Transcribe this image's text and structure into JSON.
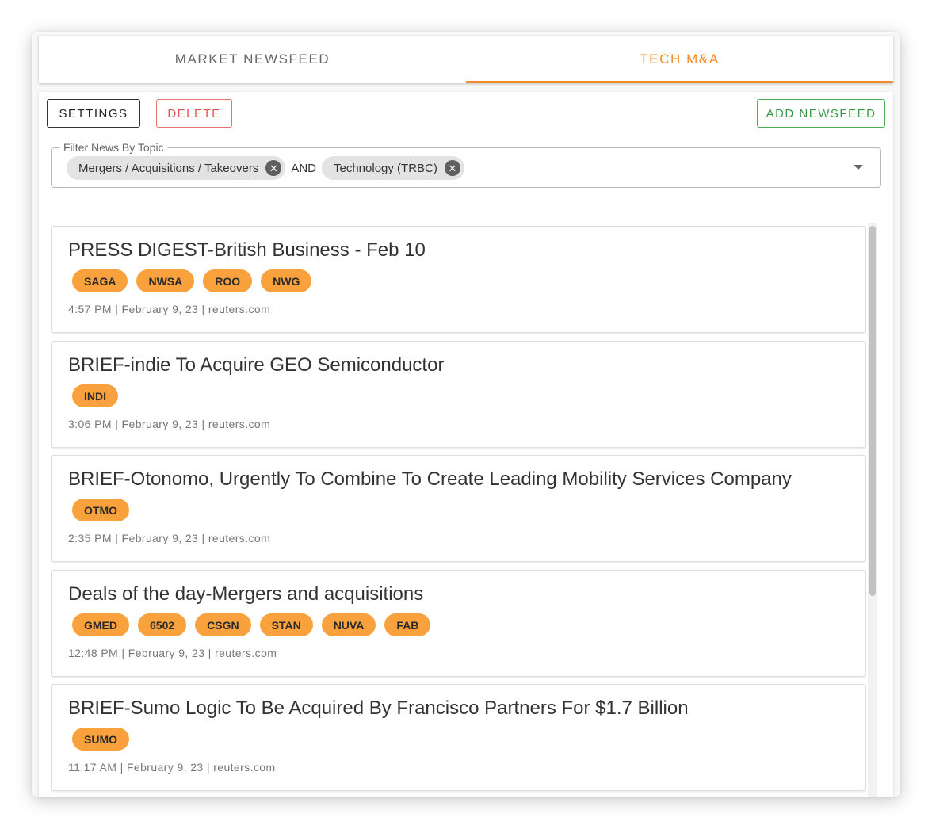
{
  "tabs": [
    {
      "label": "MARKET NEWSFEED",
      "active": false
    },
    {
      "label": "TECH M&A",
      "active": true
    }
  ],
  "toolbar": {
    "settings_label": "SETTINGS",
    "delete_label": "DELETE",
    "add_label": "ADD NEWSFEED"
  },
  "filter": {
    "label": "Filter News By Topic",
    "chips": [
      "Mergers / Acquisitions / Takeovers",
      "Technology (TRBC)"
    ],
    "joiner": "AND"
  },
  "news": [
    {
      "title": "PRESS DIGEST-British Business - Feb 10",
      "tickers": [
        "SAGA",
        "NWSA",
        "ROO",
        "NWG"
      ],
      "meta": "4:57 PM | February 9, 23 | reuters.com"
    },
    {
      "title": "BRIEF-indie To Acquire GEO Semiconductor",
      "tickers": [
        "INDI"
      ],
      "meta": "3:06 PM | February 9, 23 | reuters.com"
    },
    {
      "title": "BRIEF-Otonomo, Urgently To Combine To Create Leading Mobility Services Company",
      "tickers": [
        "OTMO"
      ],
      "meta": "2:35 PM | February 9, 23 | reuters.com"
    },
    {
      "title": "Deals of the day-Mergers and acquisitions",
      "tickers": [
        "GMED",
        "6502",
        "CSGN",
        "STAN",
        "NUVA",
        "FAB"
      ],
      "meta": "12:48 PM | February 9, 23 | reuters.com"
    },
    {
      "title": "BRIEF-Sumo Logic To Be Acquired By Francisco Partners For $1.7 Billion",
      "tickers": [
        "SUMO"
      ],
      "meta": "11:17 AM | February 9, 23 | reuters.com"
    }
  ],
  "colors": {
    "accent": "#f28c28",
    "ticker_bg": "#f8a13d",
    "delete": "#e05252",
    "add": "#3a9a46"
  }
}
